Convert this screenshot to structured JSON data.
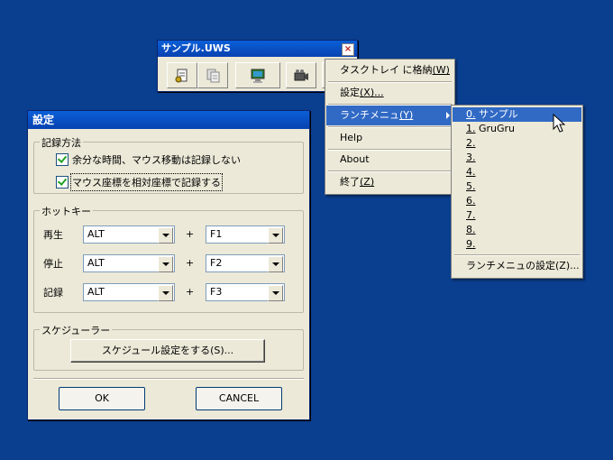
{
  "toolbar_window": {
    "title": "サンプル.UWS",
    "close_glyph": "×",
    "buttons": [
      {
        "icon": "record-doc-icon"
      },
      {
        "icon": "copy-doc-icon"
      },
      {
        "icon": "monitor-icon"
      },
      {
        "icon": "camera-icon"
      }
    ]
  },
  "context_menu": {
    "items": [
      {
        "label": "タスクトレイ に格納",
        "accel": "(W)"
      },
      {
        "label": "設定",
        "accel": "(X)..."
      },
      {
        "label": "ランチメニュ",
        "accel": "(Y)"
      },
      {
        "label": "Help"
      },
      {
        "label": "About"
      },
      {
        "label": "終了",
        "accel": "(Z)"
      }
    ]
  },
  "launch_submenu": {
    "items": [
      {
        "num": "0.",
        "label": " サンプル"
      },
      {
        "num": "1.",
        "label": " GruGru"
      },
      {
        "num": "2.",
        "label": ""
      },
      {
        "num": "3.",
        "label": ""
      },
      {
        "num": "4.",
        "label": ""
      },
      {
        "num": "5.",
        "label": ""
      },
      {
        "num": "6.",
        "label": ""
      },
      {
        "num": "7.",
        "label": ""
      },
      {
        "num": "8.",
        "label": ""
      },
      {
        "num": "9.",
        "label": ""
      }
    ],
    "settings_label": "ランチメニュの設定(Z)..."
  },
  "settings_dialog": {
    "title": "設定",
    "recording": {
      "group_label": "記録方法",
      "option1": "余分な時間、マウス移動は記録しない",
      "option2": "マウス座標を相対座標で記録する"
    },
    "hotkey": {
      "group_label": "ホットキー",
      "plus": "+",
      "rows": [
        {
          "label": "再生",
          "modifier": "ALT",
          "key": "F1"
        },
        {
          "label": "停止",
          "modifier": "ALT",
          "key": "F2"
        },
        {
          "label": "記録",
          "modifier": "ALT",
          "key": "F3"
        }
      ]
    },
    "scheduler": {
      "group_label": "スケジューラー",
      "button": "スケジュール設定をする(S)..."
    },
    "ok": "OK",
    "cancel": "CANCEL"
  },
  "colors": {
    "desktop": "#0a3e8e",
    "titlebar": "#0a5fd8",
    "menu_highlight": "#316ac5"
  }
}
